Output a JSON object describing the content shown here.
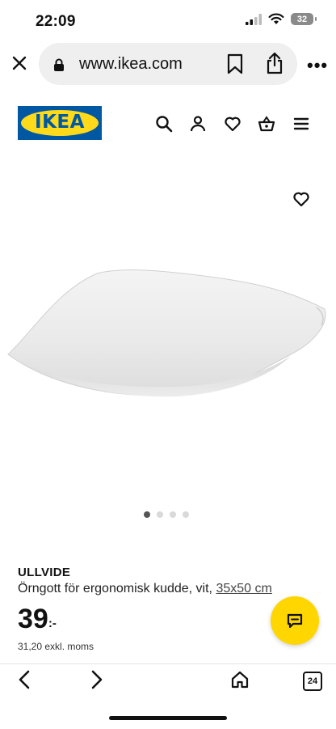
{
  "status_bar": {
    "time": "22:09",
    "battery": "32"
  },
  "browser": {
    "url": "www.ikea.com",
    "more_label": "•••"
  },
  "site": {
    "logo_text": "IKEA"
  },
  "product": {
    "name": "ULLVIDE",
    "description": "Örngott för ergonomisk kudde, vit, ",
    "size_link": "35x50 cm",
    "price": "39",
    "price_suffix": ":-",
    "price_excl_vat": "31,20 exkl. moms",
    "image_count": 4,
    "active_image": 1
  },
  "bottom_bar": {
    "tab_count": "24"
  },
  "colors": {
    "ikea_blue": "#0058a3",
    "ikea_yellow": "#ffda1a",
    "chat_button": "#ffd600"
  }
}
